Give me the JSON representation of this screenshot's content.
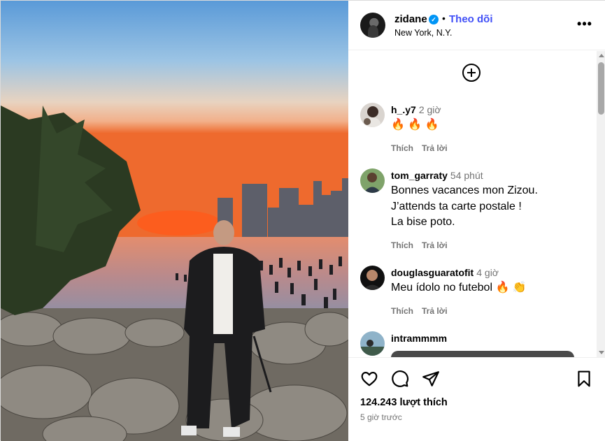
{
  "post": {
    "username": "zidane",
    "follow_label": "Theo dõi",
    "separator": "•",
    "location": "New York, N.Y.",
    "more_label": "•••"
  },
  "comments": [
    {
      "username": "h_.y7",
      "time": "2 giờ",
      "lines": [
        "🔥 🔥 🔥"
      ],
      "like_label": "Thích",
      "reply_label": "Trả lời"
    },
    {
      "username": "tom_garraty",
      "time": "54 phút",
      "lines": [
        "Bonnes vacances mon Zizou.",
        "J’attends ta carte postale !",
        "La bise poto."
      ],
      "like_label": "Thích",
      "reply_label": "Trả lời"
    },
    {
      "username": "douglasguaratofit",
      "time": "4 giờ",
      "lines": [
        "Meu ídolo no futebol 🔥 👏"
      ],
      "like_label": "Thích",
      "reply_label": "Trả lời"
    },
    {
      "username": "intrammmm",
      "time": "",
      "lines": [],
      "like_label": "",
      "reply_label": ""
    }
  ],
  "footer": {
    "likes": "124.243 lượt thích",
    "posted": "5 giờ trước"
  },
  "icons": {
    "like": "heart-icon",
    "comment": "comment-icon",
    "share": "send-icon",
    "save": "bookmark-icon",
    "add": "add-comment-icon",
    "verified": "verified-badge-icon"
  },
  "colors": {
    "accent": "#0095f6",
    "follow": "#4150f7",
    "muted": "#737373"
  }
}
